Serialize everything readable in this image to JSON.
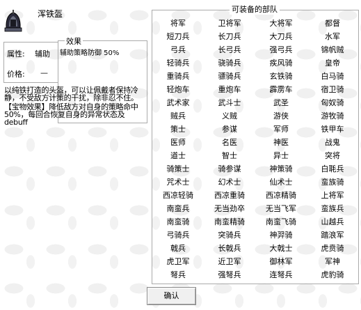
{
  "item": {
    "name": "浑铁盔",
    "icon": "helmet-icon"
  },
  "attributes": {
    "attr_label": "属性:",
    "attr_value": "辅助",
    "price_label": "价格:",
    "price_value": "—"
  },
  "effect": {
    "title": "效果",
    "text": "辅助策略防御 50%"
  },
  "description": {
    "line1": "以纯铁打造的头盔，可以让佩戴者保持冷静，不受敌方计策的干扰，除非忍不住。",
    "line2": "【宝物效果】降低敌方对自身的策略命中50%，每回合恢复自身的异常状态及debuff"
  },
  "units": {
    "title": "可装备的部队",
    "items": [
      "将军",
      "卫将军",
      "大将军",
      "都督",
      "短刀兵",
      "长刀兵",
      "大刀兵",
      "水军",
      "弓兵",
      "长弓兵",
      "强弓兵",
      "锦帆贼",
      "轻骑兵",
      "骁骑兵",
      "疾风骑",
      "皇帝",
      "重骑兵",
      "骠骑兵",
      "玄铁骑",
      "白马骑",
      "轻炮车",
      "重炮车",
      "霹雳车",
      "宿卫骑",
      "武术家",
      "武斗士",
      "武圣",
      "匈奴骑",
      "贼兵",
      "义贼",
      "游侠",
      "游牧骑",
      "策士",
      "参谋",
      "军师",
      "铁甲车",
      "医师",
      "名医",
      "神医",
      "战鬼",
      "道士",
      "智士",
      "异士",
      "突将",
      "骑策士",
      "骑参谋",
      "神策骑",
      "白毦兵",
      "咒术士",
      "幻术士",
      "仙术士",
      "蛮族骑",
      "西凉轻骑",
      "西凉重骑",
      "西凉精骑",
      "上将军",
      "南蛮兵",
      "无当劲卒",
      "无当飞军",
      "蛮族兵",
      "南蛮骑",
      "南蛮精骑",
      "南蛮飞骑",
      "山越兵",
      "弓骑兵",
      "突骑兵",
      "神羿骑",
      "踏浪军",
      "戟兵",
      "长戟兵",
      "大戟士",
      "虎贲骑",
      "虎卫军",
      "近卫军",
      "御林军",
      "军神",
      "弩兵",
      "强弩兵",
      "连弩兵",
      "虎豹骑"
    ]
  },
  "confirm_label": "确认"
}
